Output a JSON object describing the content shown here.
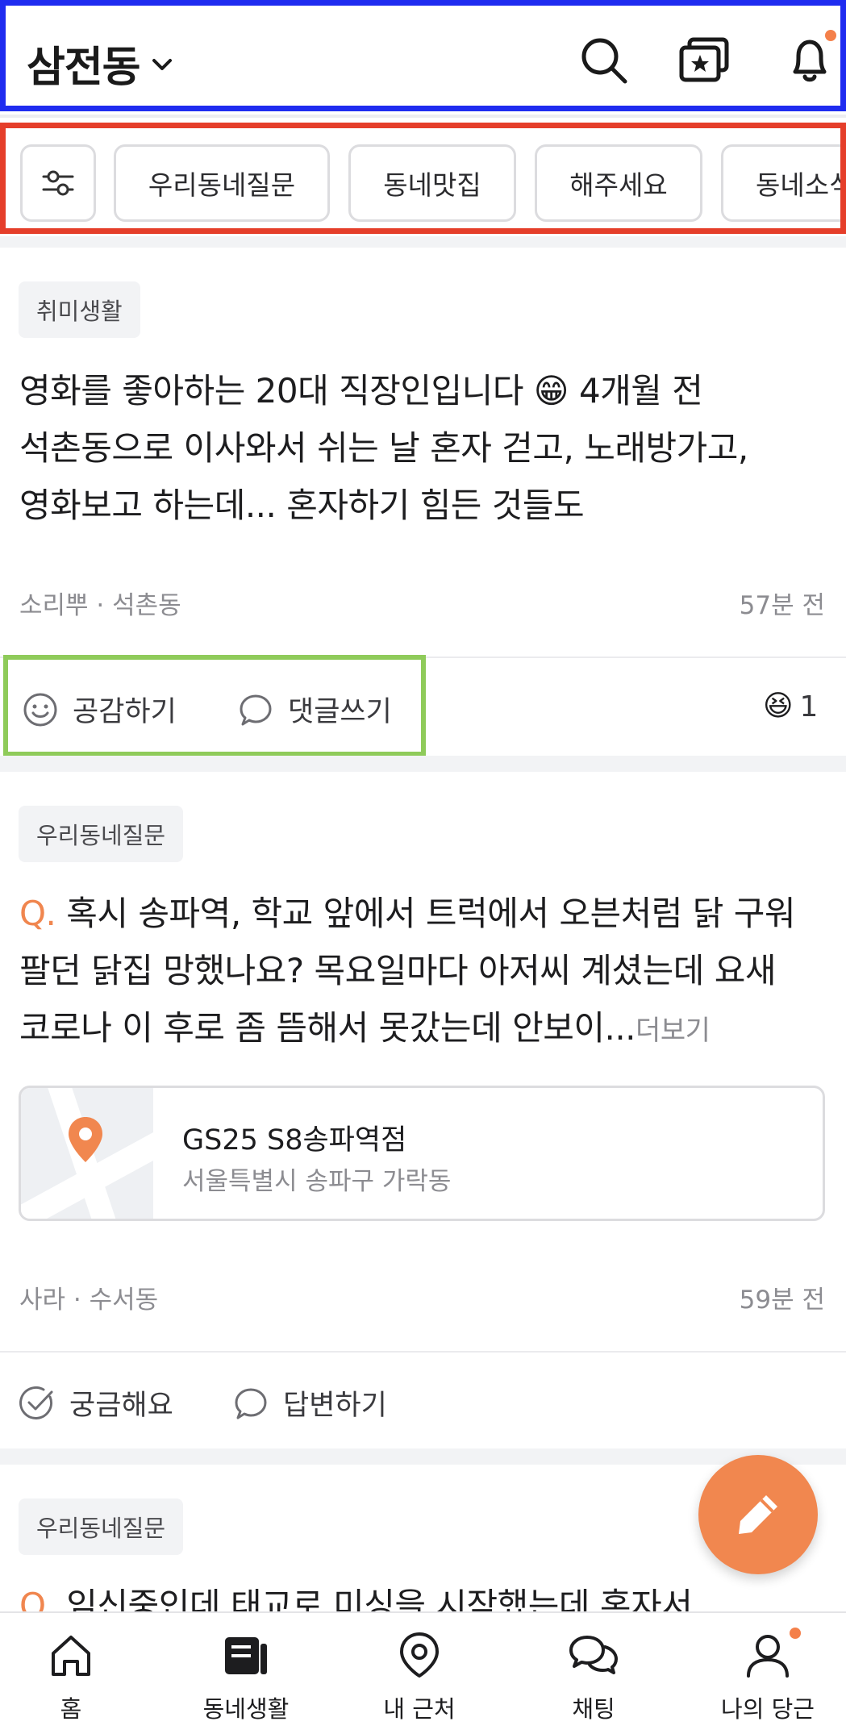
{
  "header": {
    "location": "삼전동",
    "icons": [
      "chevron-down-icon",
      "search-icon",
      "star-cards-icon",
      "bell-icon"
    ],
    "notification_dot_color": "#F4804A"
  },
  "filters": {
    "icon": "sliders-icon",
    "chips": [
      "우리동네질문",
      "동네맛집",
      "해주세요",
      "동네소식"
    ]
  },
  "posts": [
    {
      "tag": "취미생활",
      "lines": [
        "영화를 좋아하는 20대 직장인입니다 😁 4개월 전",
        "석촌동으로 이사와서 쉬는 날 혼자 걷고, 노래방가고,",
        "영화보고 하는데... 혼자하기 힘든 것들도"
      ],
      "author": "소리뿌 · 석촌동",
      "time": "57분 전",
      "actions": [
        "공감하기",
        "댓글쓰기"
      ],
      "reaction_emoji": "😆",
      "reaction_count": "1"
    },
    {
      "tag": "우리동네질문",
      "q_mark": "Q.",
      "lines": [
        " 혹시 송파역, 학교 앞에서 트럭에서 오븐처럼 닭 구워",
        "팔던 닭집 망했나요? 목요일마다 아저씨 계셨는데 요새",
        "코로나 이 후로 좀 뜸해서 못갔는데 안보이..."
      ],
      "more": "더보기",
      "place": {
        "name": "GS25 S8송파역점",
        "address": "서울특별시 송파구 가락동"
      },
      "author": "사라 · 수서동",
      "time": "59분 전",
      "actions": [
        "궁금해요",
        "답변하기"
      ]
    },
    {
      "tag": "우리동네질문",
      "q_mark": "Q.",
      "lines": [
        " 임신중인데 태교로 미싱을 시작했는데 혼자서"
      ]
    }
  ],
  "fab": {
    "icon": "pencil-icon",
    "color": "#F1874F"
  },
  "bottom_nav": [
    {
      "label": "홈",
      "icon": "home-icon"
    },
    {
      "label": "동네생활",
      "icon": "community-icon"
    },
    {
      "label": "내 근처",
      "icon": "location-pin-icon"
    },
    {
      "label": "채팅",
      "icon": "chat-icon"
    },
    {
      "label": "나의 당근",
      "icon": "profile-icon"
    }
  ],
  "colors": {
    "accent": "#F1874F",
    "header_outline": "#1F2CF0",
    "filters_outline": "#E53E2A",
    "actions_outline": "#8FCB5A"
  }
}
